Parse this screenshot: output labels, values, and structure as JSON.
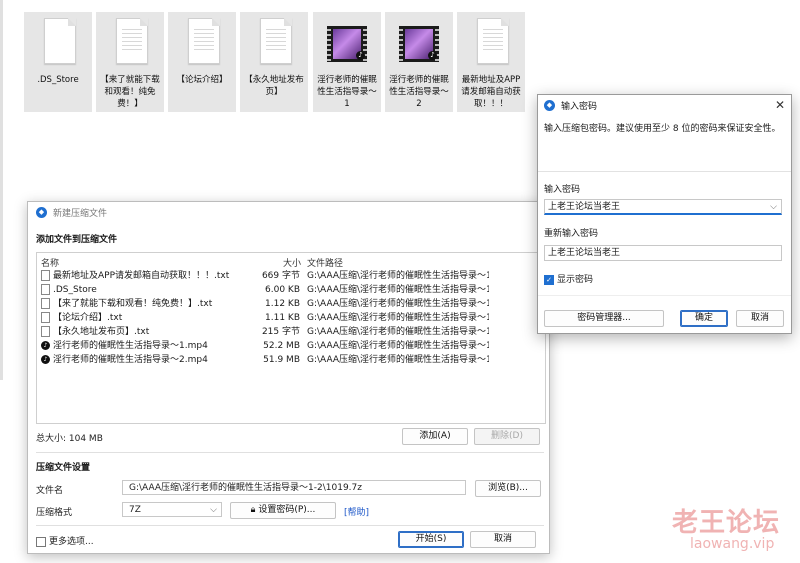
{
  "desktop": {
    "files": [
      {
        "name": ".DS_Store",
        "kind": "doc"
      },
      {
        "name": "【来了就能下载和观看！纯免费！】",
        "kind": "doc"
      },
      {
        "name": "【论坛介绍】",
        "kind": "doc"
      },
      {
        "name": "【永久地址发布页】",
        "kind": "doc"
      },
      {
        "name": "淫行老师的催眠性生活指导录～1",
        "kind": "video"
      },
      {
        "name": "淫行老师的催眠性生活指导录～2",
        "kind": "video"
      },
      {
        "name": "最新地址及APP请发邮箱自动获取！！！",
        "kind": "doc"
      }
    ]
  },
  "main_window": {
    "title": "新建压缩文件",
    "section_add": "添加文件到压缩文件",
    "columns": {
      "name": "名称",
      "size": "大小",
      "path": "文件路径"
    },
    "files": [
      {
        "name": "最新地址及APP请发邮箱自动获取！！！.txt",
        "size": "669 字节",
        "path": "G:\\AAA压缩\\淫行老师的催眠性生活指导录～1-2\\...",
        "icon": "doc"
      },
      {
        "name": ".DS_Store",
        "size": "6.00 KB",
        "path": "G:\\AAA压缩\\淫行老师的催眠性生活指导录～1-2\\...",
        "icon": "doc"
      },
      {
        "name": "【来了就能下载和观看！纯免费！】.txt",
        "size": "1.12 KB",
        "path": "G:\\AAA压缩\\淫行老师的催眠性生活指导录～1-2\\...",
        "icon": "doc"
      },
      {
        "name": "【论坛介绍】.txt",
        "size": "1.11 KB",
        "path": "G:\\AAA压缩\\淫行老师的催眠性生活指导录～1-2\\...",
        "icon": "doc"
      },
      {
        "name": "【永久地址发布页】.txt",
        "size": "215 字节",
        "path": "G:\\AAA压缩\\淫行老师的催眠性生活指导录～1-2\\...",
        "icon": "doc"
      },
      {
        "name": "淫行老师的催眠性生活指导录～1.mp4",
        "size": "52.2 MB",
        "path": "G:\\AAA压缩\\淫行老师的催眠性生活指导录～1-2\\...",
        "icon": "video"
      },
      {
        "name": "淫行老师的催眠性生活指导录～2.mp4",
        "size": "51.9 MB",
        "path": "G:\\AAA压缩\\淫行老师的催眠性生活指导录～1-2\\...",
        "icon": "video"
      }
    ],
    "total_size": "总大小: 104 MB",
    "add_button": "添加(A)",
    "delete_button": "删除(D)",
    "section_settings": "压缩文件设置",
    "filename_label": "文件名",
    "filename_value": "G:\\AAA压缩\\淫行老师的催眠性生活指导录～1-2\\1019.7z",
    "browse_button": "浏览(B)...",
    "format_label": "压缩格式",
    "format_value": "7Z",
    "set_password_button": "设置密码(P)...",
    "help_link": "[帮助]",
    "more_options": "更多选项...",
    "start_button": "开始(S)",
    "cancel_button": "取消"
  },
  "password_dialog": {
    "title": "输入密码",
    "description": "输入压缩包密码。建议使用至少 8 位的密码来保证安全性。",
    "enter_label": "输入密码",
    "enter_value": "上老王论坛当老王",
    "reenter_label": "重新输入密码",
    "reenter_value": "上老王论坛当老王",
    "show_password": "显示密码",
    "manager_button": "密码管理器...",
    "ok_button": "确定",
    "cancel_button": "取消"
  },
  "watermark": {
    "cn": "老王论坛",
    "url": "laowang.vip"
  },
  "colors": {
    "accent": "#1f6fd0",
    "watermark": "#f0b3b3"
  }
}
